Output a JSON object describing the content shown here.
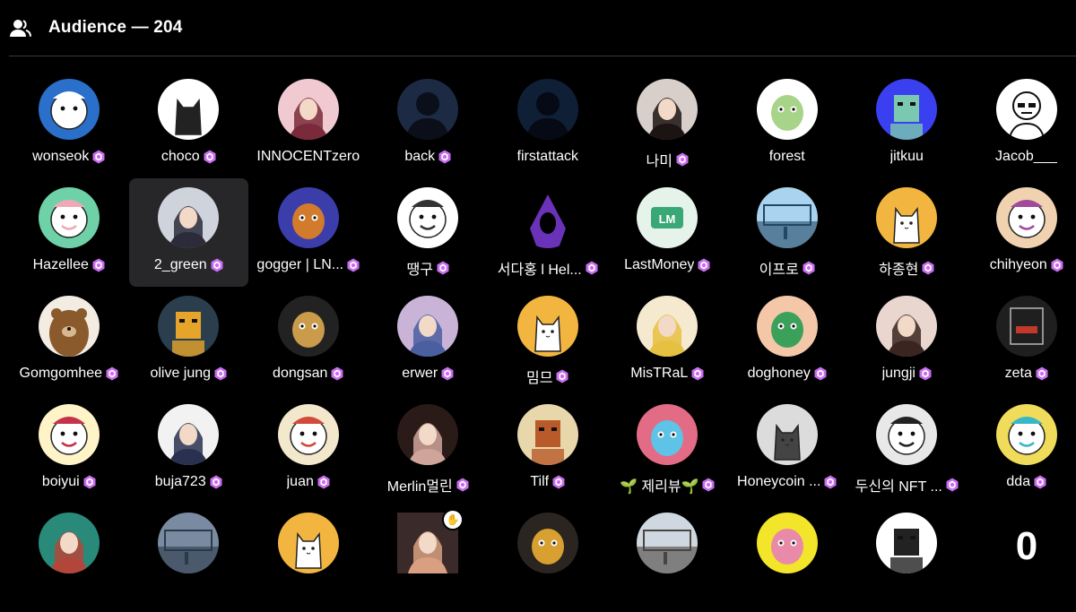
{
  "header": {
    "title": "Audience — 204"
  },
  "members": [
    {
      "name": "wonseok",
      "badge": true,
      "bg": "#2a6fc9",
      "fg": "#ffffff",
      "icon": "cartoon-face"
    },
    {
      "name": "choco",
      "badge": true,
      "bg": "#ffffff",
      "fg": "#222222",
      "icon": "cat"
    },
    {
      "name": "INNOCENTzero",
      "badge": false,
      "bg": "#f0c9d1",
      "fg": "#7a2a3a",
      "icon": "person"
    },
    {
      "name": "back",
      "badge": true,
      "bg": "#1c2a44",
      "fg": "#0b0f1a",
      "icon": "silhouette"
    },
    {
      "name": "firstattack",
      "badge": false,
      "bg": "#0f1f36",
      "fg": "#050a14",
      "icon": "silhouette"
    },
    {
      "name": "나미",
      "badge": true,
      "bg": "#d8cfcb",
      "fg": "#1b1412",
      "icon": "person"
    },
    {
      "name": "forest",
      "badge": false,
      "bg": "#ffffff",
      "fg": "#a8d48a",
      "icon": "creature"
    },
    {
      "name": "jitkuu",
      "badge": false,
      "bg": "#3a3ff0",
      "fg": "#7ac8b0",
      "icon": "pixel"
    },
    {
      "name": "Jacob___",
      "badge": false,
      "bg": "#ffffff",
      "fg": "#111111",
      "icon": "sketch"
    },
    {
      "name": "Hazellee",
      "badge": true,
      "bg": "#6fd1a7",
      "fg": "#f0a9b4",
      "icon": "cartoon-face"
    },
    {
      "name": "2_green",
      "badge": true,
      "bg": "#cfd3dc",
      "fg": "#2b2b3a",
      "icon": "person"
    },
    {
      "name": "gogger | LN...",
      "badge": true,
      "bg": "#3a3daa",
      "fg": "#d27b2c",
      "icon": "creature"
    },
    {
      "name": "땡구",
      "badge": true,
      "bg": "#ffffff",
      "fg": "#333333",
      "icon": "cartoon-face"
    },
    {
      "name": "서다홍 l Hel...",
      "badge": true,
      "bg": "#000000",
      "fg": "#6a32b8",
      "icon": "hood"
    },
    {
      "name": "LastMoney",
      "badge": true,
      "bg": "#e6f3ea",
      "fg": "#3aa776",
      "icon": "lm-logo"
    },
    {
      "name": "이프로",
      "badge": true,
      "bg": "#a9d3ee",
      "fg": "#234766",
      "icon": "scene"
    },
    {
      "name": "하종현",
      "badge": true,
      "bg": "#f2b540",
      "fg": "#ffffff",
      "icon": "cat"
    },
    {
      "name": "chihyeon",
      "badge": true,
      "bg": "#f0d2b0",
      "fg": "#a14a9c",
      "icon": "cartoon-face"
    },
    {
      "name": "Gomgomhee",
      "badge": true,
      "bg": "#f2ece2",
      "fg": "#8a5a2c",
      "icon": "bear"
    },
    {
      "name": "olive jung",
      "badge": true,
      "bg": "#2a3e4e",
      "fg": "#e6a52a",
      "icon": "pixel"
    },
    {
      "name": "dongsan",
      "badge": true,
      "bg": "#222222",
      "fg": "#c99b4a",
      "icon": "creature"
    },
    {
      "name": "erwer",
      "badge": true,
      "bg": "#c9b4d8",
      "fg": "#4a5fa0",
      "icon": "person"
    },
    {
      "name": "밈므",
      "badge": true,
      "bg": "#f2b540",
      "fg": "#ffffff",
      "icon": "cat"
    },
    {
      "name": "MisTRaL",
      "badge": true,
      "bg": "#f5ead0",
      "fg": "#e6c040",
      "icon": "person"
    },
    {
      "name": "doghoney",
      "badge": true,
      "bg": "#f3c7a8",
      "fg": "#3aa05a",
      "icon": "creature"
    },
    {
      "name": "jungji",
      "badge": true,
      "bg": "#e8d6cf",
      "fg": "#3a2520",
      "icon": "person"
    },
    {
      "name": "zeta",
      "badge": true,
      "bg": "#1f1f1f",
      "fg": "#b9b9b9",
      "icon": "box"
    },
    {
      "name": "boiyui",
      "badge": true,
      "bg": "#fff3c8",
      "fg": "#c5324a",
      "icon": "cartoon-face"
    },
    {
      "name": "buja723",
      "badge": true,
      "bg": "#f2f2f2",
      "fg": "#2a3150",
      "icon": "person"
    },
    {
      "name": "juan",
      "badge": true,
      "bg": "#f4e8cc",
      "fg": "#d14a3a",
      "icon": "cartoon-face"
    },
    {
      "name": "Merlin멀린",
      "badge": true,
      "bg": "#2a1a18",
      "fg": "#cfa59a",
      "icon": "person"
    },
    {
      "name": "Tilf",
      "badge": true,
      "bg": "#e8d7aa",
      "fg": "#b85a2a",
      "icon": "pixel"
    },
    {
      "name": "🌱 제리뷰🌱",
      "badge": true,
      "bg": "#e26b86",
      "fg": "#5ec3e6",
      "icon": "creature"
    },
    {
      "name": "Honeycoin ...",
      "badge": true,
      "bg": "#dcdcdc",
      "fg": "#444444",
      "icon": "cat"
    },
    {
      "name": "두신의 NFT ...",
      "badge": true,
      "bg": "#e8e8e8",
      "fg": "#222222",
      "icon": "cartoon-face"
    },
    {
      "name": "dda",
      "badge": true,
      "bg": "#f0dc5a",
      "fg": "#3ab6c9",
      "icon": "cartoon-face"
    },
    {
      "name": "",
      "badge": false,
      "bg": "#2a8a7a",
      "fg": "#b3463a",
      "icon": "person"
    },
    {
      "name": "",
      "badge": false,
      "bg": "#7a8aa0",
      "fg": "#2a3a4a",
      "icon": "scene"
    },
    {
      "name": "",
      "badge": false,
      "bg": "#f2b540",
      "fg": "#ffffff",
      "icon": "cat"
    },
    {
      "name": "",
      "badge": false,
      "bg": "#3a2a2a",
      "fg": "#d8a080",
      "icon": "person",
      "hand": true
    },
    {
      "name": "",
      "badge": false,
      "bg": "#2a2520",
      "fg": "#d8a030",
      "icon": "creature"
    },
    {
      "name": "",
      "badge": false,
      "bg": "#cfd8e0",
      "fg": "#4a4540",
      "icon": "scene"
    },
    {
      "name": "",
      "badge": false,
      "bg": "#f2e52a",
      "fg": "#e88aa8",
      "icon": "creature"
    },
    {
      "name": "",
      "badge": false,
      "bg": "#ffffff",
      "fg": "#222222",
      "icon": "pixel"
    },
    {
      "name": "",
      "badge": false,
      "bg": "#000000",
      "fg": "#ffffff",
      "icon": "zero"
    }
  ],
  "selected_index": 10,
  "colors": {
    "gem": "#c96cf0",
    "gem_inner": "#ffffff",
    "selected_bg": "#27272a"
  },
  "icons": {
    "header": "people-icon",
    "hand": "raised-hand-icon"
  }
}
